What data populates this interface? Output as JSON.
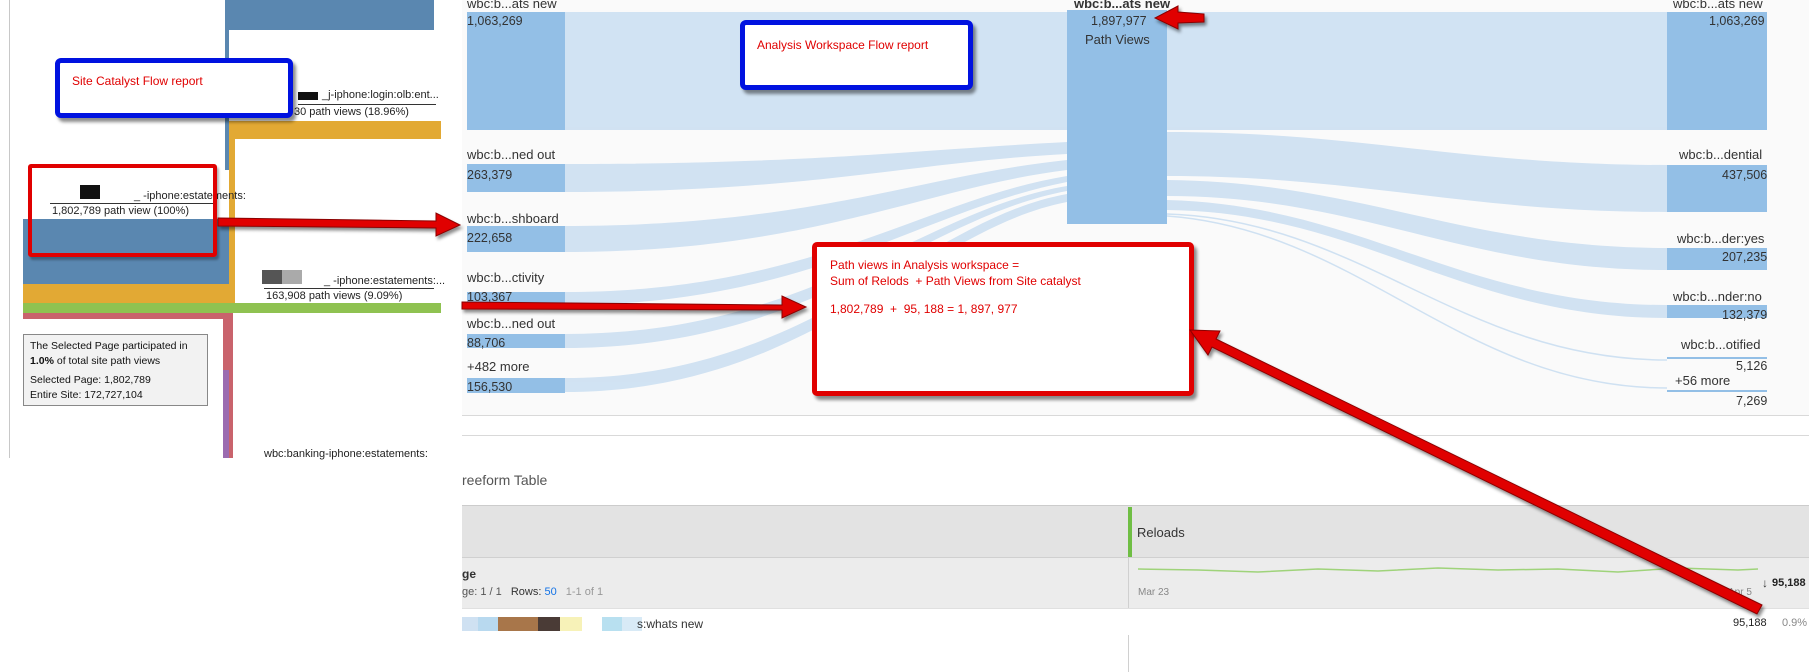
{
  "left_panel": {
    "nodes": [
      {
        "label": "_j-iphone:login:olb:ent...",
        "count": "30 path views (18.96%)"
      },
      {
        "label": "_ -iphone:estatements:",
        "count": "1,802,789 path view (100%)"
      },
      {
        "label": "_ -iphone:estatements:...",
        "count": "163,908 path views (9.09%)"
      },
      {
        "label": "wbc:banking-iphone:estatements:",
        "count": ""
      }
    ],
    "info": {
      "line1": "The Selected Page participated in",
      "pct": "1.0%",
      "line2": "of total site  path views",
      "selected": "Selected Page: 1,802,789",
      "site": "Entire Site: 172,727,104"
    },
    "colors": {
      "steel": "#5a87b0",
      "gold": "#e2a934",
      "green": "#8fc251",
      "salmon": "#c9636c",
      "purple": "#9b6bb0"
    }
  },
  "callouts": {
    "site_catalyst": "Site Catalyst Flow report",
    "workspace": "Analysis Workspace Flow report",
    "formula_lines": [
      "Path views in Analysis workspace =",
      "Sum of Relods  + Path Views from Site catalyst",
      "1,802,789  +  95, 188 = 1, 897, 977"
    ]
  },
  "flow": {
    "left_nodes": [
      {
        "label": "wbc:b...ats new",
        "value": "1,063,269"
      },
      {
        "label": "wbc:b...ned out",
        "value": "263,379"
      },
      {
        "label": "wbc:b...shboard",
        "value": "222,658"
      },
      {
        "label": "wbc:b...ctivity",
        "value": "103,367"
      },
      {
        "label": "wbc:b...ned out",
        "value": "88,706"
      },
      {
        "label": "+482 more",
        "value": "156,530"
      }
    ],
    "center_node": {
      "label": "wbc:b...ats new",
      "value": "1,897,977",
      "metric": "Path Views"
    },
    "right_nodes": [
      {
        "label": "wbc:b...ats new",
        "value": "1,063,269"
      },
      {
        "label": "wbc:b...dential",
        "value": "437,506"
      },
      {
        "label": "wbc:b...der:yes",
        "value": "207,235"
      },
      {
        "label": "wbc:b...nder:no",
        "value": "132,379"
      },
      {
        "label": "wbc:b...otified",
        "value": "5,126"
      },
      {
        "label": "+56 more",
        "value": "7,269"
      }
    ]
  },
  "table": {
    "title": "reeform Table",
    "column": "Reloads",
    "dimension": "ge",
    "pager": "ge: 1 / 1",
    "rows_label": "Rows:",
    "rows_value": "50",
    "range": "1-1 of 1",
    "date_start": "Mar 23",
    "date_end": "Apr 5",
    "total": "95,188",
    "row": {
      "label": "s:whats new",
      "value": "95,188",
      "pct": "0.9%"
    },
    "colors": {
      "accent": "#6fbe44",
      "spark": "#9fd37a",
      "blue": "#1473e6"
    }
  }
}
